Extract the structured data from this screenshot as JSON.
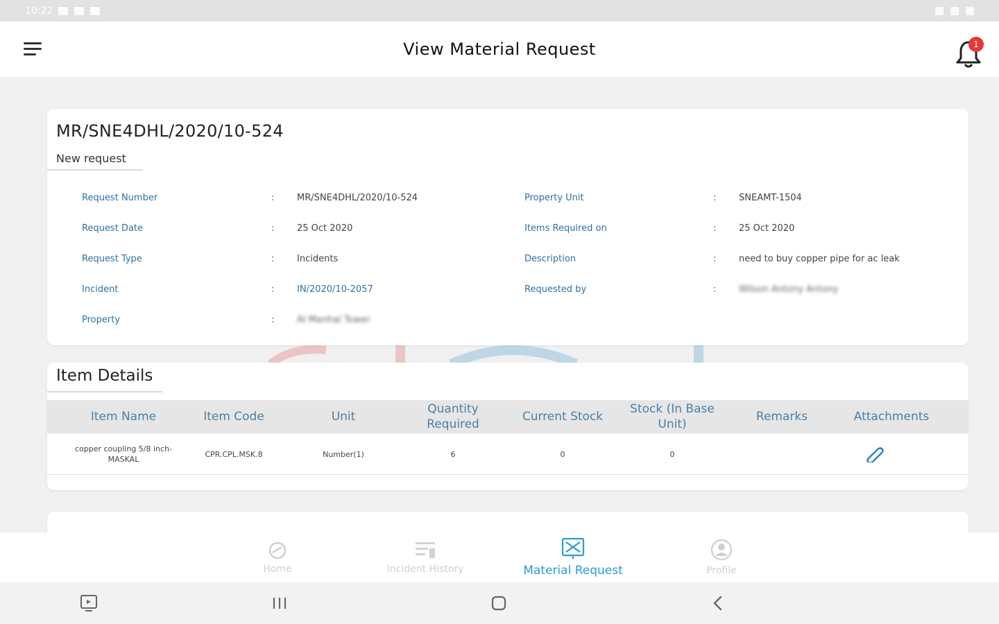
{
  "status_bar": {
    "time": "10:22"
  },
  "header": {
    "title": "View Material Request",
    "notification_count": "1"
  },
  "request": {
    "number": "MR/SNE4DHL/2020/10-524",
    "status": "New request",
    "fields_left": [
      {
        "label": "Request Number",
        "value": "MR/SNE4DHL/2020/10-524"
      },
      {
        "label": "Request Date",
        "value": "25 Oct 2020"
      },
      {
        "label": "Request Type",
        "value": "Incidents"
      },
      {
        "label": "Incident",
        "value": "IN/2020/10-2057"
      },
      {
        "label": "Property",
        "value": "Al Manhal Tower"
      }
    ],
    "fields_right": [
      {
        "label": "Property Unit",
        "value": "SNEAMT-1504"
      },
      {
        "label": "Items Required on",
        "value": "25 Oct 2020"
      },
      {
        "label": "Description",
        "value": "need to buy copper pipe for ac leak"
      },
      {
        "label": "Requested by",
        "value": "Wilson Antony Antony"
      }
    ],
    "separator": ":"
  },
  "items": {
    "title": "Item Details",
    "columns": [
      "Item Name",
      "Item Code",
      "Unit",
      "Quantity Required",
      "Current Stock",
      "Stock (In Base Unit)",
      "Remarks",
      "Attachments"
    ],
    "rows": [
      [
        "copper coupling 5/8 inch-MASKAL",
        "CPR.CPL.MSK.8",
        "Number(1)",
        "6",
        "0",
        "0",
        ""
      ]
    ]
  },
  "bottom_nav": [
    {
      "label": "Home",
      "icon": "home-icon"
    },
    {
      "label": "Incident History",
      "icon": "incident-history-icon"
    },
    {
      "label": "Material Request",
      "icon": "material-request-icon",
      "active": true
    },
    {
      "label": "Profile",
      "icon": "profile-icon"
    }
  ],
  "colors": {
    "accent": "#2a9ad6",
    "label": "#2f6fa8",
    "badge": "#e53935"
  }
}
